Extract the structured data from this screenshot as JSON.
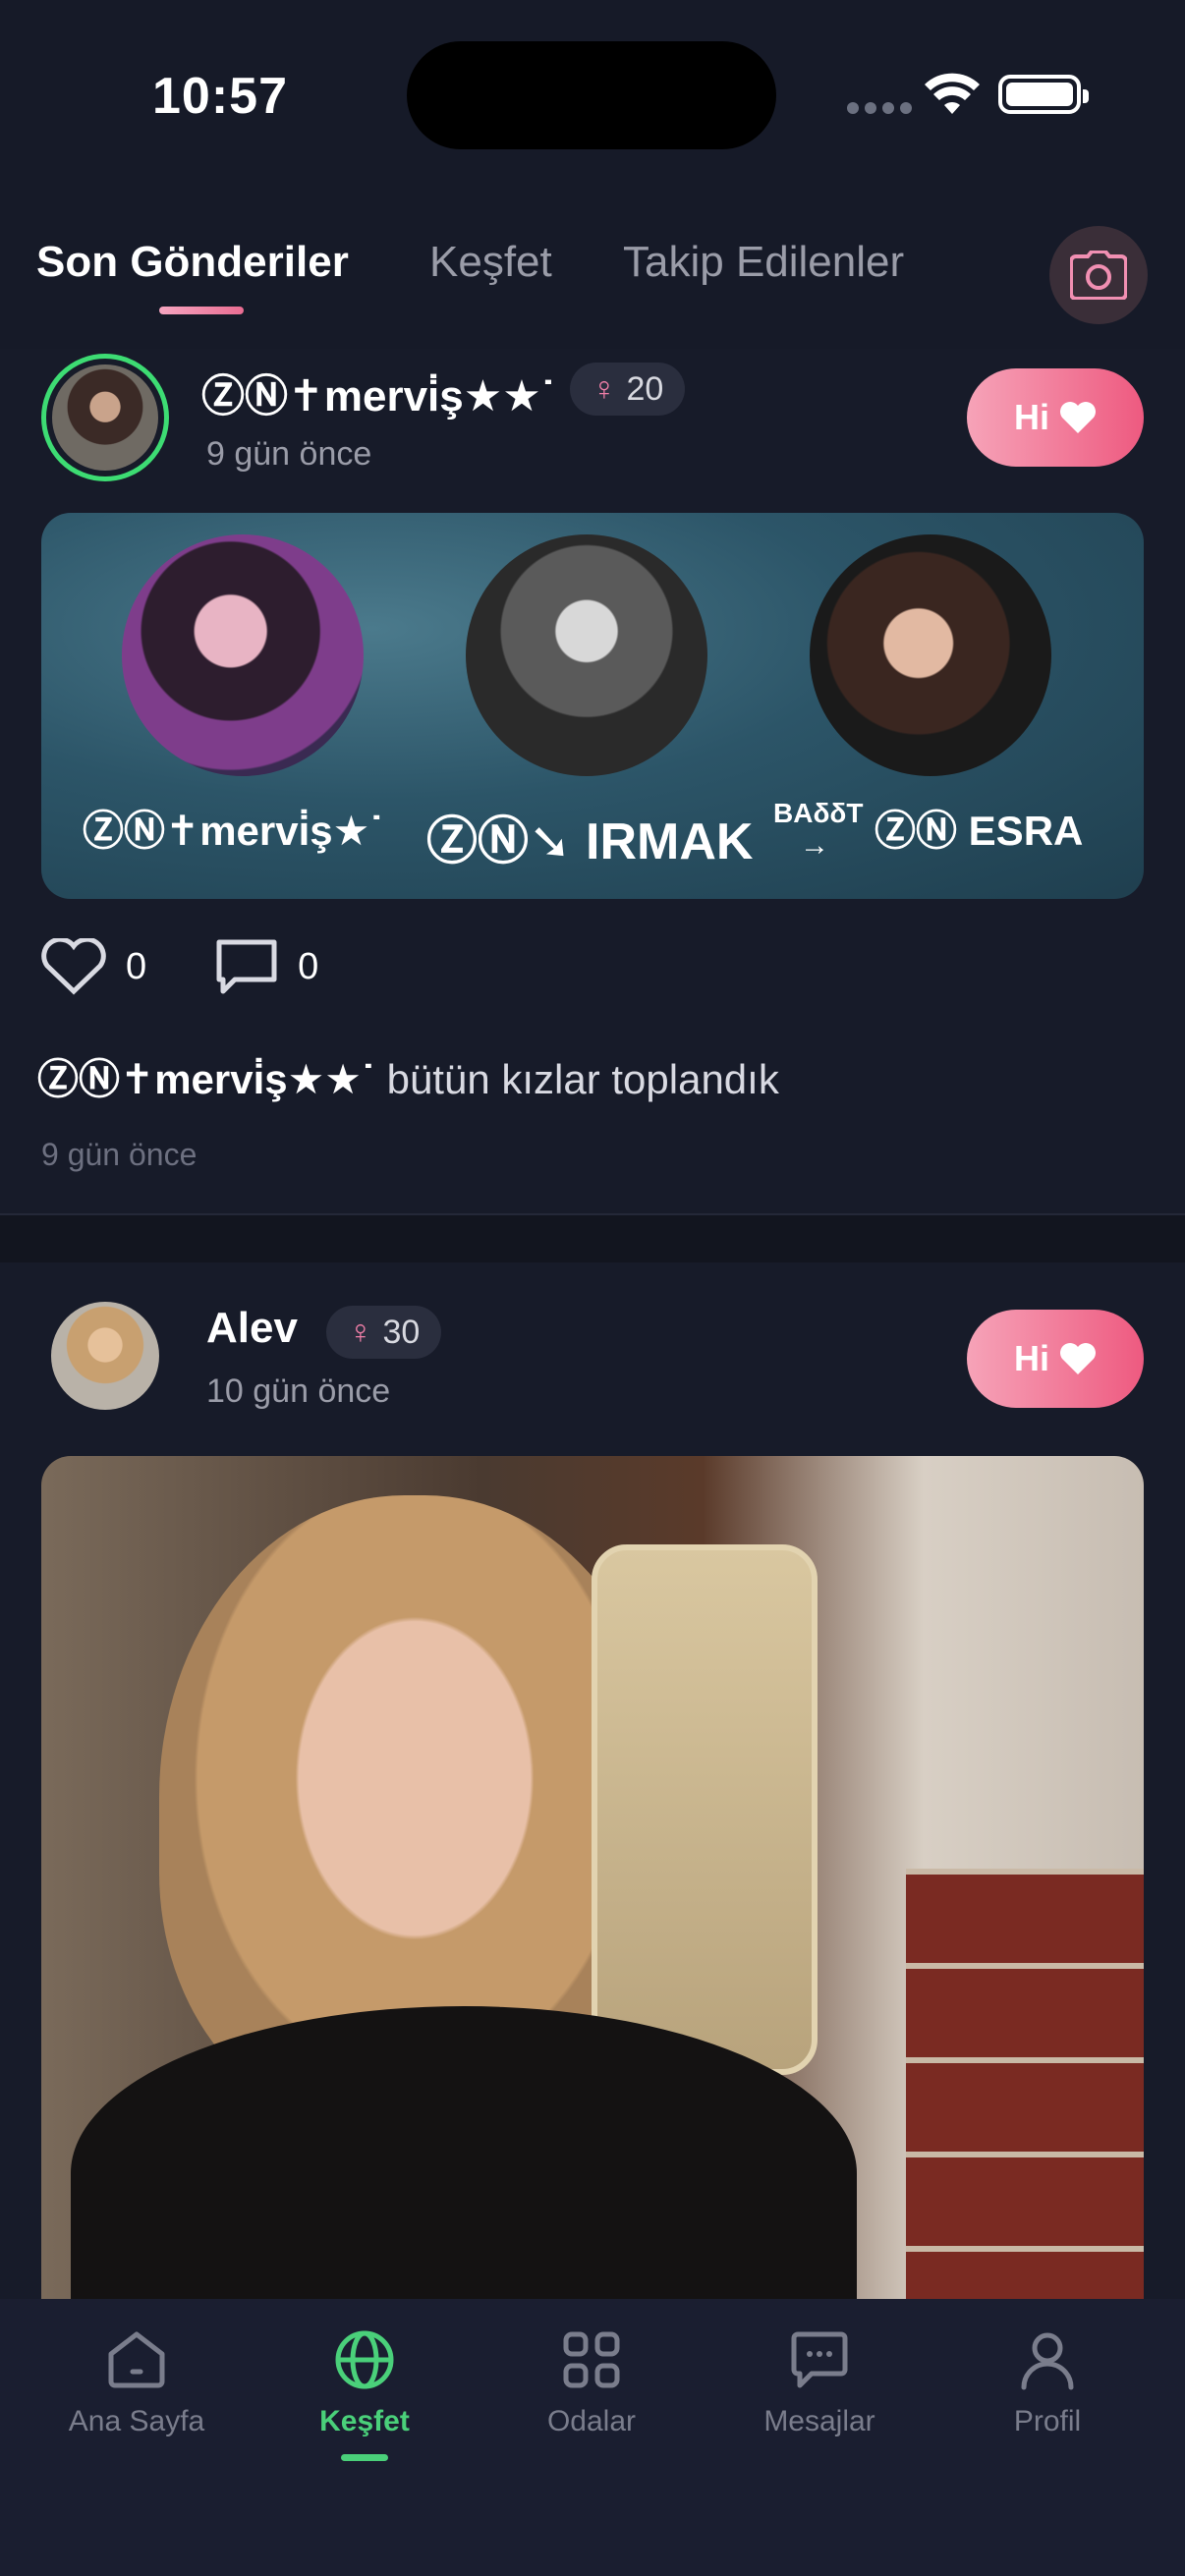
{
  "status_bar": {
    "time": "10:57"
  },
  "tabs": [
    {
      "label": "Son Gönderiler",
      "active": true
    },
    {
      "label": "Keşfet",
      "active": false
    },
    {
      "label": "Takip Edilenler",
      "active": false
    }
  ],
  "camera_icon": "camera-icon",
  "posts": [
    {
      "username": "ⓏⓃ✝mervi̇ş★★˙",
      "age": "20",
      "time_ago": "9 gün önce",
      "hi_label": "Hi",
      "image_labels": [
        "ⓏⓃ✝mervi̇ş★˙",
        "ⓏⓃ➘ IRMAK",
        "BAδδT",
        "→",
        "ⓏⓃ ESRA"
      ],
      "likes": "0",
      "comments": "0",
      "caption_user": "ⓏⓃ✝mervi̇ş★★˙",
      "caption_text": " bütün kızlar toplandık",
      "caption_time": "9 gün önce"
    },
    {
      "username": "Alev",
      "age": "30",
      "time_ago": "10 gün önce",
      "hi_label": "Hi"
    }
  ],
  "bottom_nav": [
    {
      "label": "Ana Sayfa",
      "icon": "home-icon",
      "active": false
    },
    {
      "label": "Keşfet",
      "icon": "globe-icon",
      "active": true
    },
    {
      "label": "Odalar",
      "icon": "grid-icon",
      "active": false
    },
    {
      "label": "Mesajlar",
      "icon": "chat-icon",
      "active": false
    },
    {
      "label": "Profil",
      "icon": "profile-icon",
      "active": false
    }
  ],
  "colors": {
    "background": "#161a28",
    "accent_pink": "#ee5a80",
    "accent_green": "#4ad07a",
    "nav_background": "#1a1e30"
  }
}
